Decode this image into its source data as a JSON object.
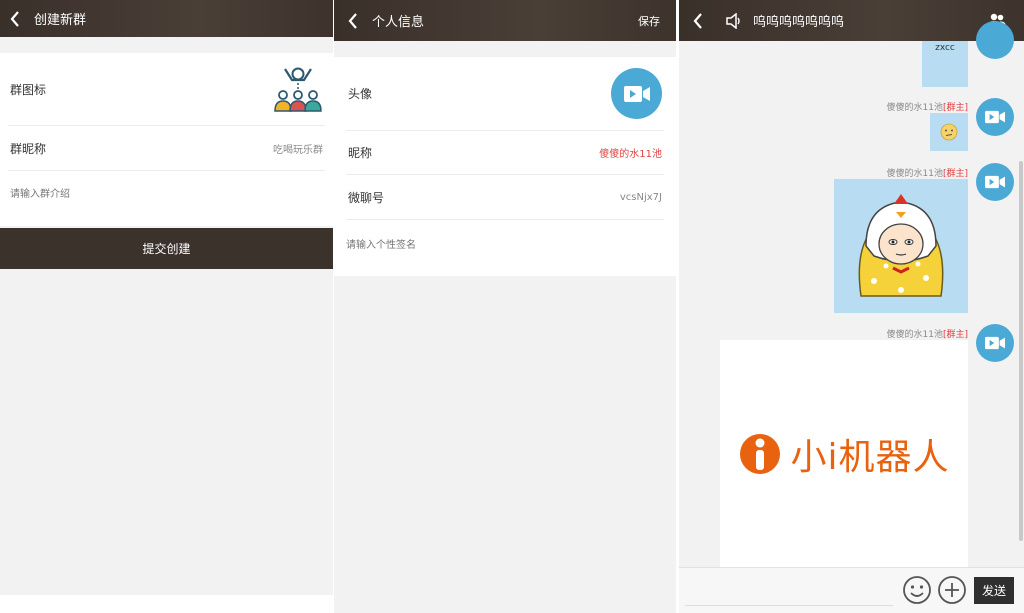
{
  "create_group": {
    "title": "创建新群",
    "icon_label": "群图标",
    "nickname_label": "群昵称",
    "nickname_value": "吃喝玩乐群",
    "intro_placeholder": "请输入群介绍",
    "submit_label": "提交创建"
  },
  "profile": {
    "title": "个人信息",
    "save_label": "保存",
    "avatar_label": "头像",
    "nickname_label": "昵称",
    "nickname_value": "傻傻的水11池",
    "wechat_label": "微聊号",
    "wechat_value": "vcsNjx7J",
    "signature_placeholder": "请输入个性签名"
  },
  "chat": {
    "title": "呜呜呜呜呜呜呜",
    "first_message": "zxcc",
    "messages": [
      {
        "sender": "傻傻的水11池",
        "role": "[群主]",
        "type": "emoji"
      },
      {
        "sender": "傻傻的水11池",
        "role": "[群主]",
        "type": "sticker"
      },
      {
        "sender": "傻傻的水11池",
        "role": "[群主]",
        "type": "image",
        "brand_text": "小i机器人"
      }
    ],
    "send_label": "发送"
  },
  "colors": {
    "accent_blue": "#4ba9d6",
    "header_dark": "#3b322c",
    "red": "#e04040",
    "brand_orange": "#e8620f"
  }
}
